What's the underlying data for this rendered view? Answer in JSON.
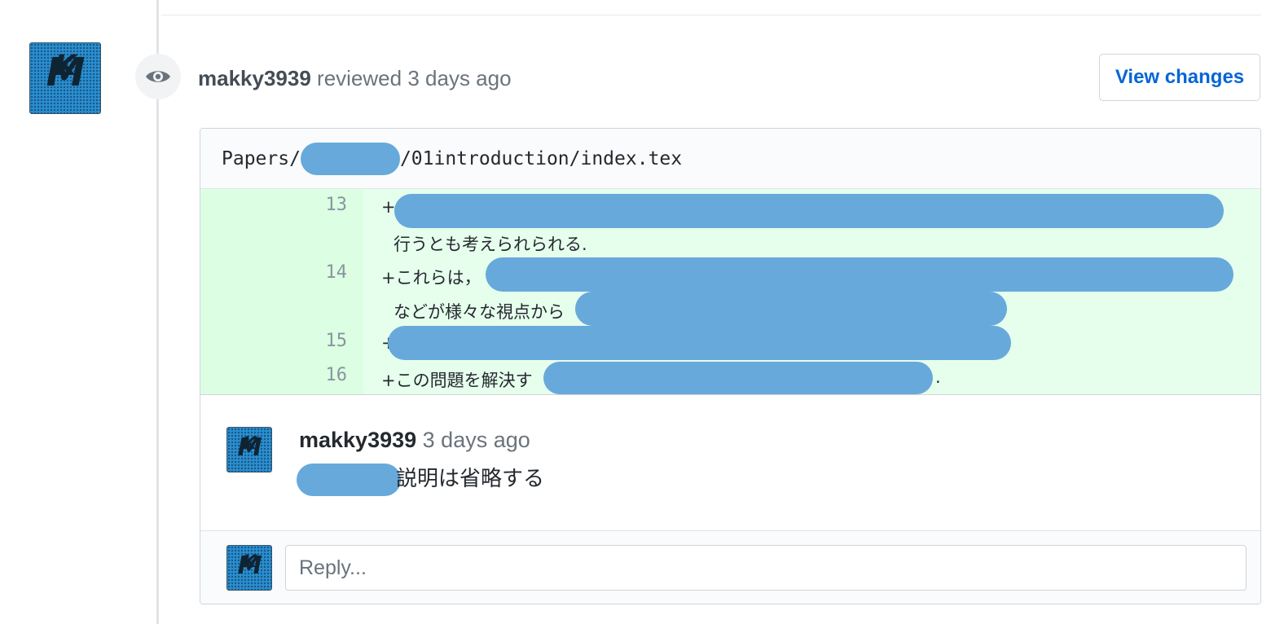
{
  "avatar_text": "MK",
  "review": {
    "author": "makky3939",
    "action": "reviewed",
    "time": "3 days ago",
    "view_changes_label": "View changes"
  },
  "file": {
    "path_prefix": "Papers/",
    "path_suffix": "/01introduction/index.tex"
  },
  "diff": {
    "lines": [
      {
        "number": "13",
        "text": "+"
      },
      {
        "number": "",
        "text": "行うとも考えられられる."
      },
      {
        "number": "14",
        "text": "+これらは，"
      },
      {
        "number": "",
        "text": "などが様々な視点から"
      },
      {
        "number": "15",
        "text": "+"
      },
      {
        "number": "16",
        "text": "+この問題を解決す"
      }
    ],
    "line16_tail": "."
  },
  "comment": {
    "author": "makky3939",
    "time": "3 days ago",
    "body": "説明は省略する"
  },
  "reply": {
    "placeholder": "Reply..."
  },
  "colors": {
    "accent": "#0366d6",
    "diff_added_bg": "#e6ffed",
    "diff_gutter_bg": "#dcffe4",
    "redaction": "#67a9db"
  }
}
